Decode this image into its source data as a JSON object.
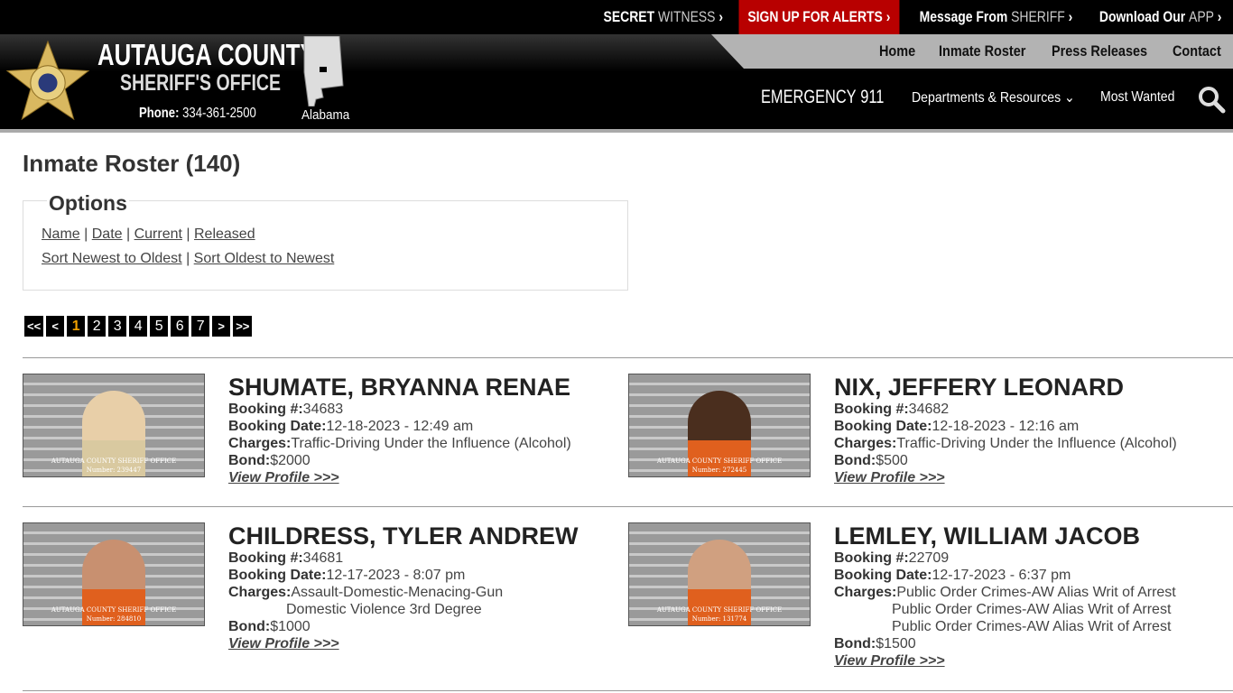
{
  "topbar": [
    {
      "a": "SECRET",
      "b": "WITNESS"
    },
    {
      "a": "SIGN UP FOR ALERTS",
      "b": ""
    },
    {
      "a": "Message From",
      "b": "SHERIFF"
    },
    {
      "a": "Download Our",
      "b": "APP"
    }
  ],
  "header": {
    "title": "AUTAUGA COUNTY",
    "subtitle": "SHERIFF'S OFFICE",
    "phone_label": "Phone:",
    "phone": "334-361-2500",
    "state": "Alabama",
    "emergency_label": "EMERGENCY",
    "emergency_number": "911",
    "departments": "Departments & Resources",
    "most_wanted": "Most Wanted"
  },
  "nav": [
    "Home",
    "Inmate Roster",
    "Press Releases",
    "Contact"
  ],
  "page": {
    "title": "Inmate Roster (140)",
    "options_legend": "Options",
    "sort_links": [
      "Name",
      "Date",
      "Current",
      "Released"
    ],
    "order_links": [
      "Sort Newest to Oldest",
      "Sort Oldest to Newest"
    ]
  },
  "pager": {
    "first": "<<",
    "prev": "<",
    "pages": [
      "1",
      "2",
      "3",
      "4",
      "5",
      "6",
      "7"
    ],
    "current": "1",
    "next": ">",
    "last": ">>"
  },
  "labels": {
    "booking": "Booking #:",
    "date": "Booking Date:",
    "charges": "Charges:",
    "bond": "Bond:",
    "view": "View Profile >>>",
    "photo_caption": "AUTAUGA COUNTY SHERIFF OFFICE"
  },
  "inmates": [
    {
      "name": "SHUMATE, BRYANNA RENAE",
      "booking": "34683",
      "date": "12-18-2023 - 12:49 am",
      "charges": [
        "Traffic-Driving Under the Influence (Alcohol)"
      ],
      "bond": "$2000",
      "photo_number": "Number: 239447"
    },
    {
      "name": "NIX, JEFFERY LEONARD",
      "booking": "34682",
      "date": "12-18-2023 - 12:16 am",
      "charges": [
        "Traffic-Driving Under the Influence (Alcohol)"
      ],
      "bond": "$500",
      "photo_number": "Number: 272445"
    },
    {
      "name": "CHILDRESS, TYLER ANDREW",
      "booking": "34681",
      "date": "12-17-2023 - 8:07 pm",
      "charges": [
        "Assault-Domestic-Menacing-Gun",
        "Domestic Violence 3rd Degree"
      ],
      "bond": "$1000",
      "photo_number": "Number: 284810"
    },
    {
      "name": "LEMLEY, WILLIAM JACOB",
      "booking": "22709",
      "date": "12-17-2023 - 6:37 pm",
      "charges": [
        "Public Order Crimes-AW Alias Writ of Arrest",
        "Public Order Crimes-AW Alias Writ of Arrest",
        "Public Order Crimes-AW Alias Writ of Arrest"
      ],
      "bond": "$1500",
      "photo_number": "Number: 131774"
    }
  ]
}
